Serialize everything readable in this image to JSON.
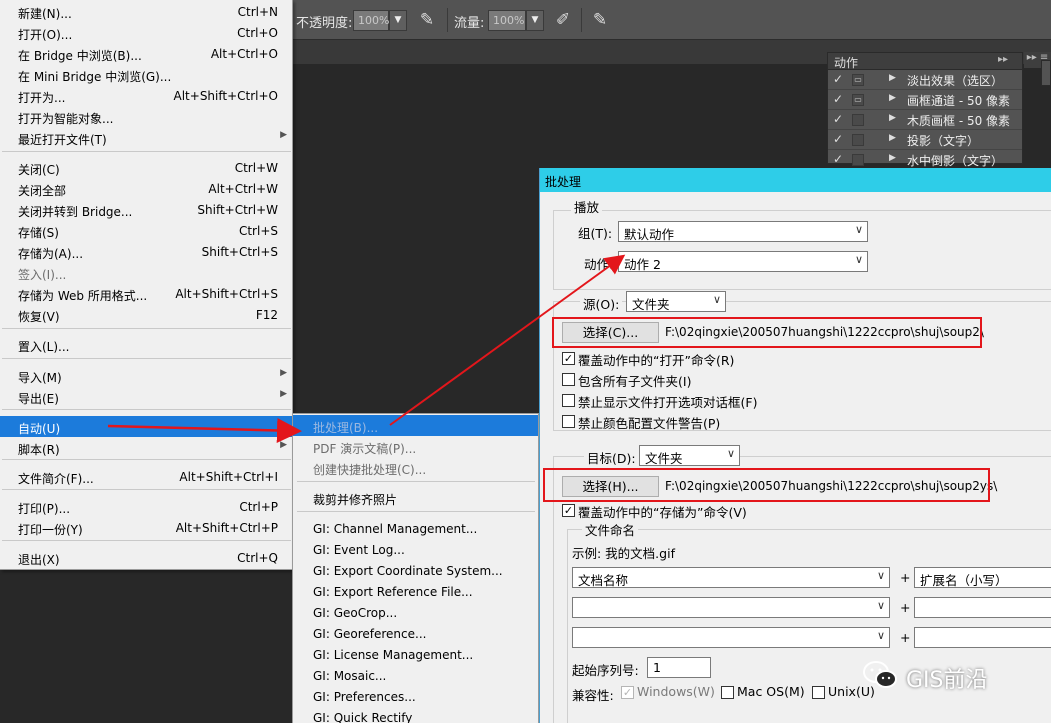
{
  "options_bar": {
    "opacity_label": "不透明度:",
    "opacity_value": "100%",
    "flow_label": "流量:",
    "flow_value": "100%"
  },
  "actions_panel": {
    "title": "动作",
    "items": [
      {
        "name": "淡出效果（选区）",
        "checked": true,
        "dialog": true
      },
      {
        "name": "画框通道 - 50 像素",
        "checked": true,
        "dialog": true
      },
      {
        "name": "木质画框 - 50 像素",
        "checked": true,
        "dialog": false
      },
      {
        "name": "投影（文字）",
        "checked": true,
        "dialog": false
      },
      {
        "name": "水中倒影（文字）",
        "checked": true,
        "dialog": false
      }
    ]
  },
  "file_menu": {
    "items": [
      {
        "label": "新建(N)...",
        "shortcut": "Ctrl+N"
      },
      {
        "label": "打开(O)...",
        "shortcut": "Ctrl+O"
      },
      {
        "label": "在 Bridge 中浏览(B)...",
        "shortcut": "Alt+Ctrl+O"
      },
      {
        "label": "在 Mini Bridge 中浏览(G)...",
        "shortcut": ""
      },
      {
        "label": "打开为...",
        "shortcut": "Alt+Shift+Ctrl+O"
      },
      {
        "label": "打开为智能对象...",
        "shortcut": ""
      },
      {
        "label": "最近打开文件(T)",
        "shortcut": ""
      },
      {
        "label": "关闭(C)",
        "shortcut": "Ctrl+W"
      },
      {
        "label": "关闭全部",
        "shortcut": "Alt+Ctrl+W"
      },
      {
        "label": "关闭并转到 Bridge...",
        "shortcut": "Shift+Ctrl+W"
      },
      {
        "label": "存储(S)",
        "shortcut": "Ctrl+S"
      },
      {
        "label": "存储为(A)...",
        "shortcut": "Shift+Ctrl+S"
      },
      {
        "label": "签入(I)...",
        "shortcut": ""
      },
      {
        "label": "存储为 Web 所用格式...",
        "shortcut": "Alt+Shift+Ctrl+S"
      },
      {
        "label": "恢复(V)",
        "shortcut": "F12"
      },
      {
        "label": "置入(L)...",
        "shortcut": ""
      },
      {
        "label": "导入(M)",
        "shortcut": ""
      },
      {
        "label": "导出(E)",
        "shortcut": ""
      },
      {
        "label": "自动(U)",
        "shortcut": ""
      },
      {
        "label": "脚本(R)",
        "shortcut": ""
      },
      {
        "label": "文件简介(F)...",
        "shortcut": "Alt+Shift+Ctrl+I"
      },
      {
        "label": "打印(P)...",
        "shortcut": "Ctrl+P"
      },
      {
        "label": "打印一份(Y)",
        "shortcut": "Alt+Shift+Ctrl+P"
      },
      {
        "label": "退出(X)",
        "shortcut": "Ctrl+Q"
      }
    ]
  },
  "automate_submenu": {
    "items": [
      {
        "label": "批处理(B)..."
      },
      {
        "label": "PDF 演示文稿(P)..."
      },
      {
        "label": "创建快捷批处理(C)..."
      },
      {
        "label": "裁剪并修齐照片"
      },
      {
        "label": "GI: Channel Management..."
      },
      {
        "label": "GI: Event Log..."
      },
      {
        "label": "GI: Export Coordinate System..."
      },
      {
        "label": "GI: Export Reference File..."
      },
      {
        "label": "GI: GeoCrop..."
      },
      {
        "label": "GI: Georeference..."
      },
      {
        "label": "GI: License Management..."
      },
      {
        "label": "GI: Mosaic..."
      },
      {
        "label": "GI: Preferences..."
      },
      {
        "label": "GI: Quick Rectify"
      }
    ]
  },
  "batch_dialog": {
    "title": "批处理",
    "play": {
      "legend": "播放",
      "set_label": "组(T):",
      "set_value": "默认动作",
      "action_label": "动作:",
      "action_value": "动作 2"
    },
    "source": {
      "label": "源(O):",
      "value": "文件夹",
      "choose_button": "选择(C)...",
      "path": "F:\\02qingxie\\200507huangshi\\1222ccpro\\shuj\\soup2\\",
      "options": [
        {
          "label": "覆盖动作中的“打开”命令(R)",
          "checked": true
        },
        {
          "label": "包含所有子文件夹(I)",
          "checked": false
        },
        {
          "label": "禁止显示文件打开选项对话框(F)",
          "checked": false
        },
        {
          "label": "禁止颜色配置文件警告(P)",
          "checked": false
        }
      ]
    },
    "destination": {
      "label": "目标(D):",
      "value": "文件夹",
      "choose_button": "选择(H)...",
      "path": "F:\\02qingxie\\200507huangshi\\1222ccpro\\shuj\\soup2ys\\",
      "override_label": "覆盖动作中的“存储为”命令(V)",
      "override_checked": true
    },
    "file_naming": {
      "legend": "文件命名",
      "example": "示例: 我的文档.gif",
      "row1_left": "文档名称",
      "row1_right": "扩展名（小写）",
      "plus": "+",
      "serial_label": "起始序列号:",
      "serial_value": "1",
      "compat_label": "兼容性:",
      "compat": [
        {
          "label": "Windows(W)",
          "checked": true,
          "disabled": true
        },
        {
          "label": "Mac OS(M)",
          "checked": false,
          "disabled": false
        },
        {
          "label": "Unix(U)",
          "checked": false,
          "disabled": false
        }
      ]
    }
  },
  "watermark": {
    "text": "GIS前沿"
  },
  "colors": {
    "menu_highlight": "#1c7bdb",
    "dialog_titlebar": "#2ecde8",
    "annotation_red": "#e3161b"
  }
}
